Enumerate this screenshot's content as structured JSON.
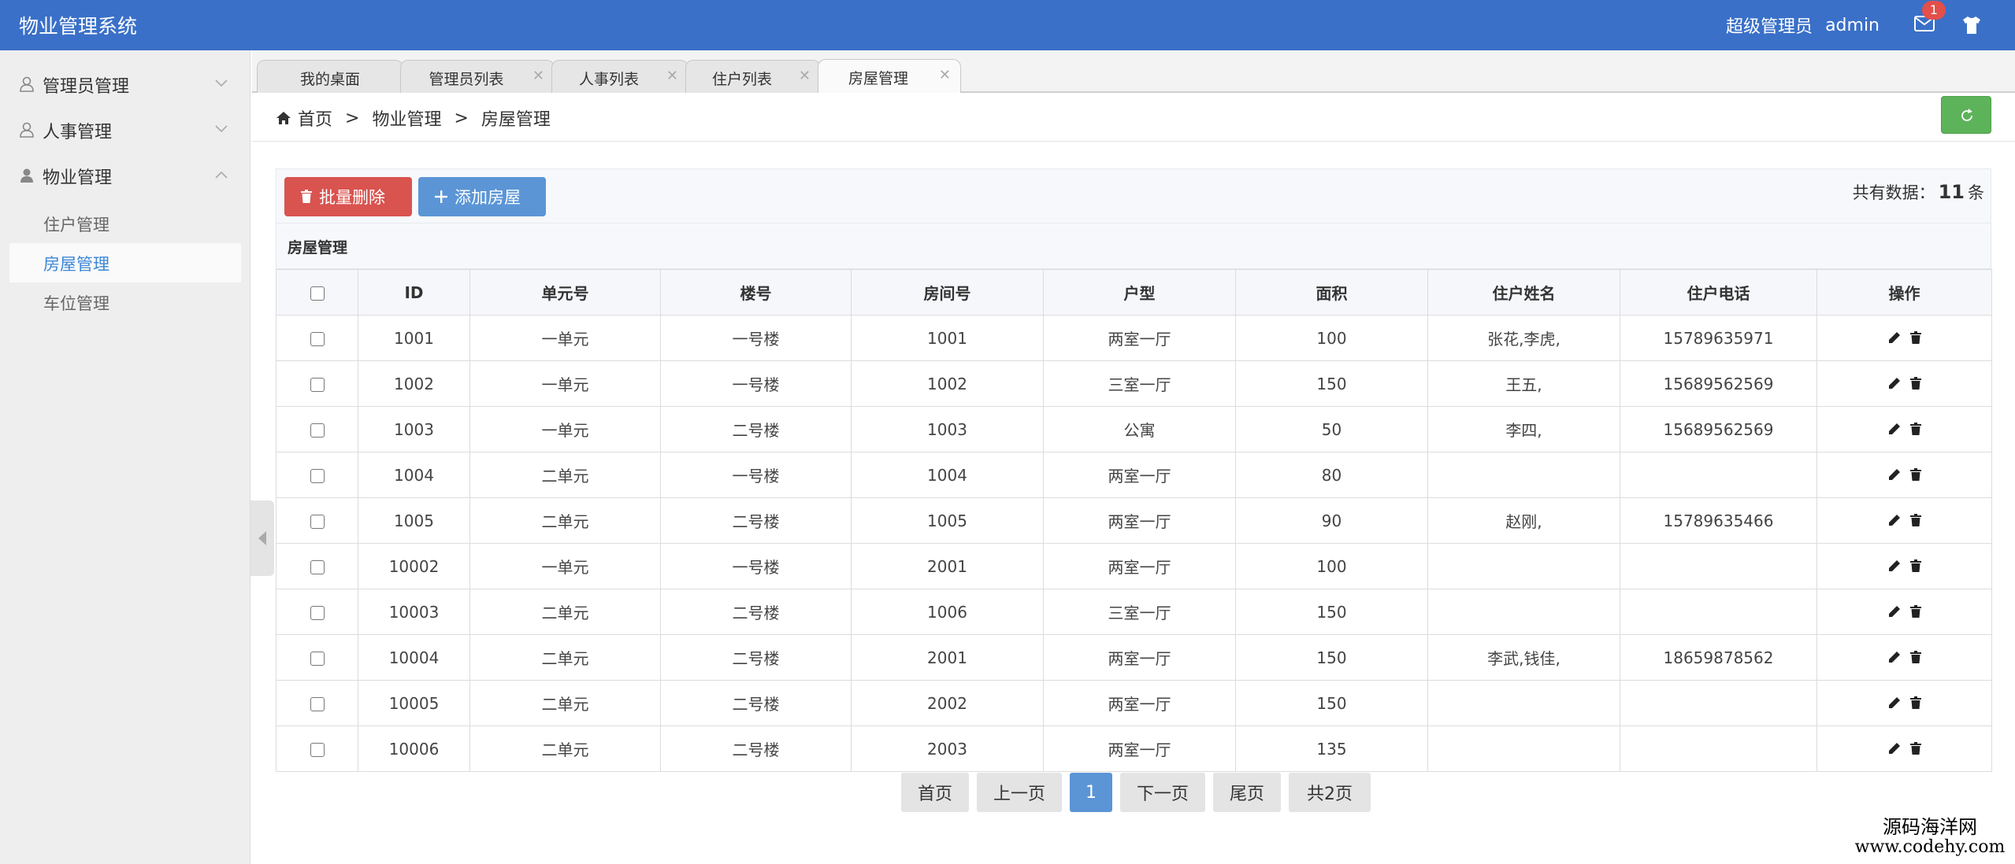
{
  "app": {
    "title": "物业管理系统"
  },
  "header": {
    "role": "超级管理员",
    "user": "admin",
    "mail_badge": "1",
    "icons": [
      "mail-icon",
      "tshirt-icon"
    ]
  },
  "sidebar": {
    "groups": [
      {
        "label": "管理员管理",
        "icon": "user-outline-icon",
        "expanded": false
      },
      {
        "label": "人事管理",
        "icon": "user-outline-icon",
        "expanded": false
      },
      {
        "label": "物业管理",
        "icon": "user-solid-icon",
        "expanded": true
      }
    ],
    "subitems": [
      {
        "label": "住户管理",
        "active": false
      },
      {
        "label": "房屋管理",
        "active": true
      },
      {
        "label": "车位管理",
        "active": false
      }
    ]
  },
  "tabs": [
    {
      "label": "我的桌面",
      "closable": false
    },
    {
      "label": "管理员列表",
      "closable": true
    },
    {
      "label": "人事列表",
      "closable": true
    },
    {
      "label": "住户列表",
      "closable": true
    },
    {
      "label": "房屋管理",
      "closable": true,
      "active": true
    }
  ],
  "breadcrumb": {
    "items": [
      "首页",
      "物业管理",
      "房屋管理"
    ],
    "separator": ">"
  },
  "toolbar": {
    "batch_delete": "批量删除",
    "add_house": "添加房屋",
    "total_prefix": "共有数据：",
    "total_count": "11",
    "total_suffix": "条"
  },
  "table": {
    "caption": "房屋管理",
    "headers": [
      "ID",
      "单元号",
      "楼号",
      "房间号",
      "户型",
      "面积",
      "住户姓名",
      "住户电话",
      "操作"
    ],
    "rows": [
      [
        "1001",
        "一单元",
        "一号楼",
        "1001",
        "两室一厅",
        "100",
        "张花,李虎,",
        "15789635971"
      ],
      [
        "1002",
        "一单元",
        "一号楼",
        "1002",
        "三室一厅",
        "150",
        "王五,",
        "15689562569"
      ],
      [
        "1003",
        "一单元",
        "二号楼",
        "1003",
        "公寓",
        "50",
        "李四,",
        "15689562569"
      ],
      [
        "1004",
        "二单元",
        "一号楼",
        "1004",
        "两室一厅",
        "80",
        "",
        ""
      ],
      [
        "1005",
        "二单元",
        "二号楼",
        "1005",
        "两室一厅",
        "90",
        "赵刚,",
        "15789635466"
      ],
      [
        "10002",
        "一单元",
        "一号楼",
        "2001",
        "两室一厅",
        "100",
        "",
        ""
      ],
      [
        "10003",
        "二单元",
        "二号楼",
        "1006",
        "三室一厅",
        "150",
        "",
        ""
      ],
      [
        "10004",
        "二单元",
        "二号楼",
        "2001",
        "两室一厅",
        "150",
        "李武,钱佳,",
        "18659878562"
      ],
      [
        "10005",
        "二单元",
        "二号楼",
        "2002",
        "两室一厅",
        "150",
        "",
        ""
      ],
      [
        "10006",
        "二单元",
        "二号楼",
        "2003",
        "两室一厅",
        "135",
        "",
        ""
      ]
    ]
  },
  "pagination": {
    "first": "首页",
    "prev": "上一页",
    "current": "1",
    "next": "下一页",
    "last": "尾页",
    "total_pages": "共2页"
  },
  "watermark": {
    "line1": "源码海洋网",
    "line2": "www.codehy.com"
  },
  "colors": {
    "header": "#3a70c8",
    "danger": "#d9534f",
    "primary": "#5b95d6",
    "success": "#5db35a",
    "active_link": "#3b86d6"
  }
}
